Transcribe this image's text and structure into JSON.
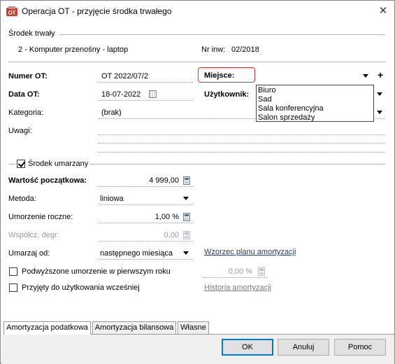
{
  "window": {
    "title": "Operacja OT - przyjęcie środka trwałego"
  },
  "asset": {
    "section_label": "Środek trwały",
    "name": "2 - Komputer przenośny - laptop",
    "inv_label": "Nr inw:",
    "inv_value": "02/2018"
  },
  "form": {
    "numer_label": "Numer OT:",
    "numer_value": "OT 2022/07/2",
    "data_label": "Data OT:",
    "data_value": "18-07-2022",
    "kategoria_label": "Kategoria:",
    "kategoria_value": "(brak)",
    "uwagi_label": "Uwagi:",
    "miejsce_label": "Miejsce:",
    "uzytkownik_label": "Użytkownik:",
    "miejsce_options": [
      "Biuro",
      "Sad",
      "Sala konferencyjna",
      "Salon sprzedaży"
    ]
  },
  "depreciation": {
    "checkbox_label": "Środek umarzany",
    "checked": true,
    "wartosc_label": "Wartość początkowa:",
    "wartosc_value": "4 999,00",
    "metoda_label": "Metoda:",
    "metoda_value": "liniowa",
    "umorzenie_label": "Umorzenie roczne:",
    "umorzenie_value": "1,00 %",
    "wspolcz_label": "Współcz. degr:",
    "wspolcz_value": "0,00",
    "umarzaj_label": "Umarzaj od:",
    "umarzaj_value": "następnego miesiąca",
    "wzorzec_link": "Wzorzec planu amortyzacji",
    "podwyzszone_label": "Podwyższone umorzenie w pierwszym roku",
    "podwyzszone_value": "0,00 %",
    "przyjety_label": "Przyjęty do użytkowania wcześniej",
    "historia_link": "Historia amortyzacji"
  },
  "tabs": [
    "Amortyzacja podatkowa",
    "Amortyzacja bilansowa",
    "Własne"
  ],
  "buttons": {
    "ok": "OK",
    "anuluj": "Anuluj",
    "pomoc": "Pomoc"
  },
  "icons": {
    "app": "asset-app-icon",
    "close": "close-icon",
    "calc": "calculator-icon",
    "calendar": "calendar-icon",
    "dropdown": "chevron-down-icon",
    "add": "plus-icon"
  },
  "colors": {
    "highlight": "#e03030",
    "link": "#2a3a6a",
    "default_button_border": "#0078d7"
  }
}
